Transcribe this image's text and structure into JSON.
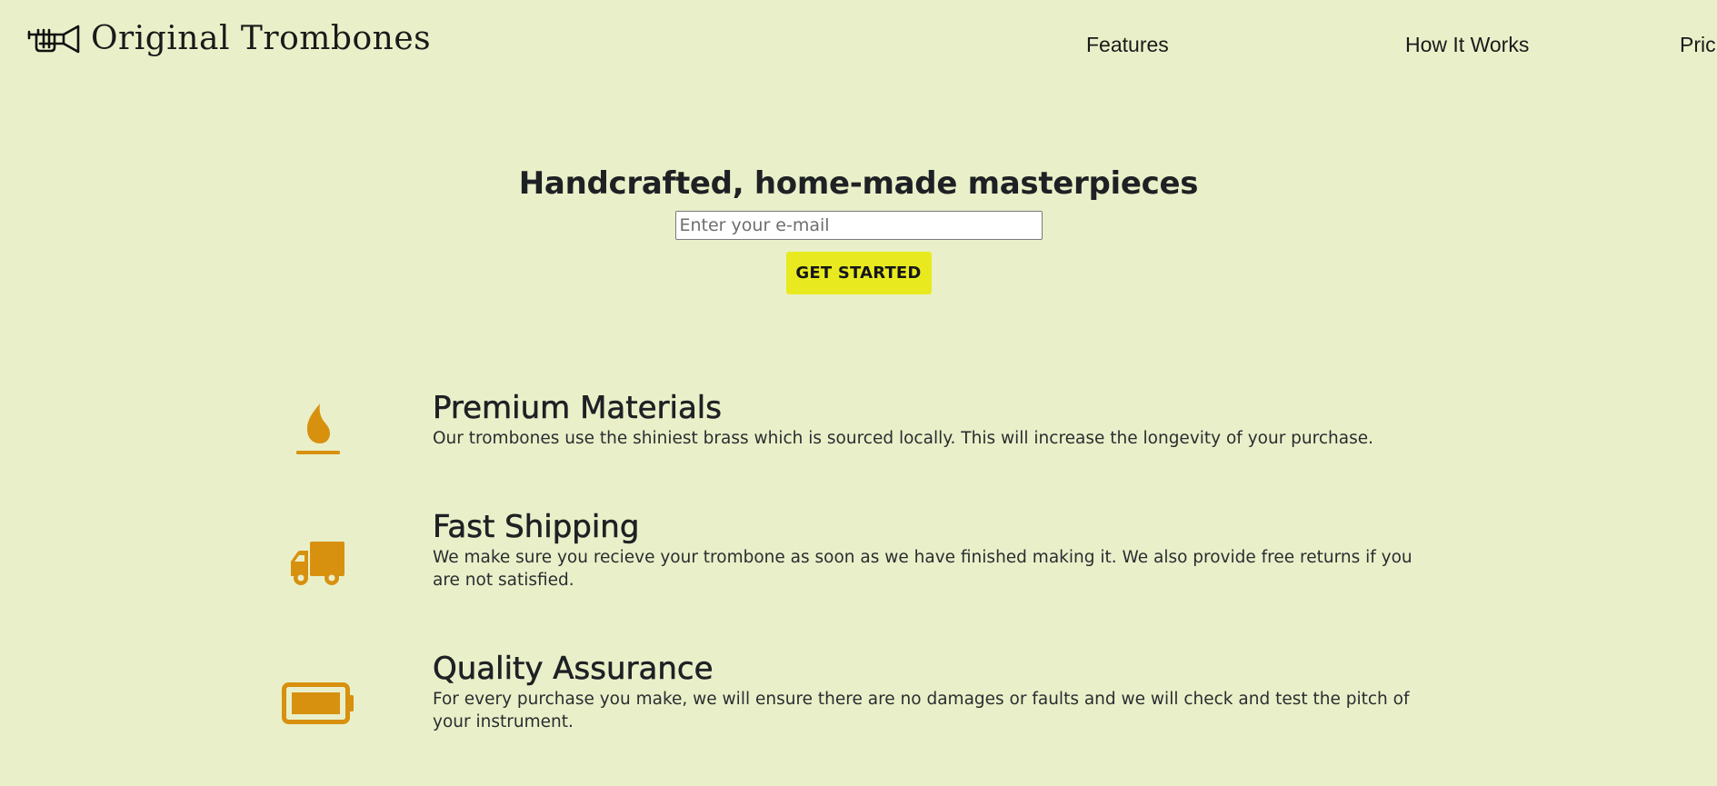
{
  "header": {
    "brand": "Original Trombones",
    "nav": [
      {
        "label": "Features"
      },
      {
        "label": "How It Works"
      },
      {
        "label": "Pricing"
      }
    ]
  },
  "hero": {
    "title": "Handcrafted, home-made masterpieces",
    "email_placeholder": "Enter your e-mail",
    "cta_label": "GET STARTED"
  },
  "features": [
    {
      "icon": "fire-icon",
      "title": "Premium Materials",
      "description": "Our trombones use the shiniest brass which is sourced locally. This will increase the longevity of your purchase."
    },
    {
      "icon": "truck-icon",
      "title": "Fast Shipping",
      "description": "We make sure you recieve your trombone as soon as we have finished making it. We also provide free returns if you are not satisfied."
    },
    {
      "icon": "battery-full-icon",
      "title": "Quality Assurance",
      "description": "For every purchase you make, we will ensure there are no damages or faults and we will check and test the pitch of your instrument."
    }
  ],
  "colors": {
    "background": "#e9f0c9",
    "accent_icon": "#d8900f",
    "cta_button": "#e8ea1f",
    "text": "#1e2124"
  }
}
